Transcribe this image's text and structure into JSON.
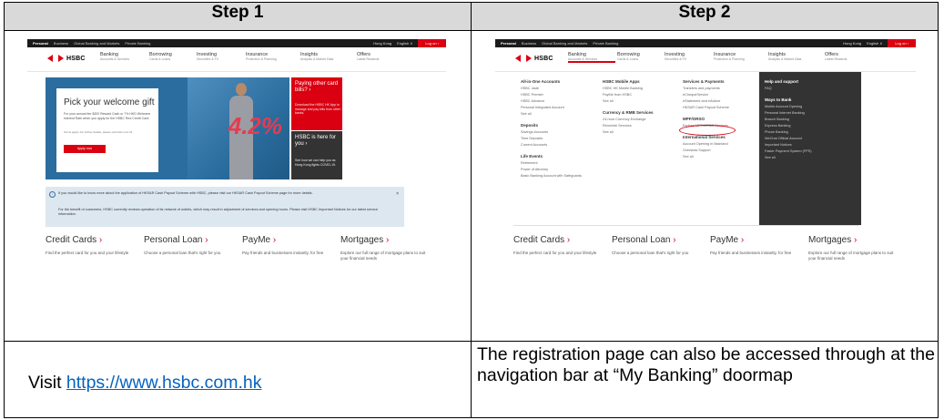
{
  "table": {
    "step1_header": "Step 1",
    "step2_header": "Step 2",
    "step1_caption_prefix": "Visit ",
    "step1_link": "https://www.hsbc.com.hk",
    "step2_caption": "The registration page can also be accessed through  at the navigation bar at “My Banking” doormap"
  },
  "shot1": {
    "topbar": [
      "Personal",
      "Business",
      "Global Banking and Markets",
      "Private Banking"
    ],
    "topbar_right": [
      "Hong Kong",
      "English ∨",
      "Log on ›"
    ],
    "logo": "HSBC",
    "nav": [
      {
        "main": "Banking",
        "sub": "Accounts & Services"
      },
      {
        "main": "Borrowing",
        "sub": "Cards & Loans"
      },
      {
        "main": "Investing",
        "sub": "Securities & FX"
      },
      {
        "main": "Insurance",
        "sub": "Protection & Planning"
      },
      {
        "main": "Insights",
        "sub": "Analysis & Market Data"
      },
      {
        "main": "Offers",
        "sub": "Latest Rewards"
      }
    ],
    "hero": {
      "title": "Pick your welcome gift",
      "text": "For your annual fee $300 Reward Cash or 7% HKD Welcome Interest Rate when you apply for the HSBC Red Credit Card.",
      "fine": "Terms apply. For further details, please visit hsbc.com.hk",
      "button": "Apply now",
      "big": "4.2%"
    },
    "side_a": {
      "title": "Paying other card bills? ›",
      "text": "Download the HSBC HK App to manage and pay bills from other banks."
    },
    "side_b": {
      "title": "HSBC is here for you ›",
      "text": "See how we can help you as Hong Kong fights COVID-19."
    },
    "notice": {
      "line1": "If you would like to know more about the application of HKSAR Cash Payout Scheme with HSBC, please visit our HKSAR Cash Payout Scheme page for more details.",
      "line2": "For the benefit of customers, HSBC currently reviews operation of its network of outlets, which may result in adjustment of services and opening hours. Please visit HSBC Important Notices for our latest service information.",
      "close": "×"
    },
    "products": [
      {
        "title": "Credit Cards",
        "desc": "Find the perfect card for you and your lifestyle"
      },
      {
        "title": "Personal Loan",
        "desc": "Choose a personal loan that's right for you"
      },
      {
        "title": "PayMe",
        "desc": "Pay friends and businesses instantly, for free"
      },
      {
        "title": "Mortgages",
        "desc": "Explore our full range of mortgage plans to suit your financial needs"
      }
    ]
  },
  "shot2": {
    "doormap": {
      "col1": {
        "h1": "All-in-One Accounts",
        "i1": [
          "HSBC Jade",
          "HSBC Premier",
          "HSBC Advance",
          "Personal Integrated Account",
          "See all"
        ],
        "h2": "Deposits",
        "i2": [
          "Savings Accounts",
          "Time Deposits",
          "Current Accounts"
        ],
        "h3": "Life Events",
        "i3": [
          "Retirement",
          "Power of Attorney",
          "Basic Banking Account with Safeguards"
        ]
      },
      "col2": {
        "h1": "HSBC Mobile Apps",
        "i1": [
          "HSBC HK Mobile Banking",
          "PayMe from HSBC",
          "See all"
        ],
        "h2": "Currency & RMB Services",
        "i2": [
          "24-hour Currency Exchange",
          "Renminbi Services",
          "See all"
        ]
      },
      "col3": {
        "h1": "Services & Payments",
        "i1": [
          "Transfers and payments",
          "eChequeService",
          "eStatement and eAdvice",
          "HKSAR Cash Payout Scheme"
        ],
        "h2": "MPF/ORSO",
        "i2": [
          "Explore MPF/ORSO Services"
        ],
        "h3": "International Services",
        "i3": [
          "Account Opening in Mainland",
          "Overseas Support",
          "See all"
        ]
      },
      "col4": {
        "h1": "Help and support",
        "i1": [
          "FAQ"
        ],
        "h2": "Ways to Bank",
        "i2": [
          "Mobile Account Opening",
          "Personal Internet Banking",
          "Branch Banking",
          "Express Banking",
          "Phone Banking",
          "WeChat Official Account",
          "Important Notices",
          "Faster Payment System (FPS)",
          "See all"
        ]
      }
    }
  }
}
